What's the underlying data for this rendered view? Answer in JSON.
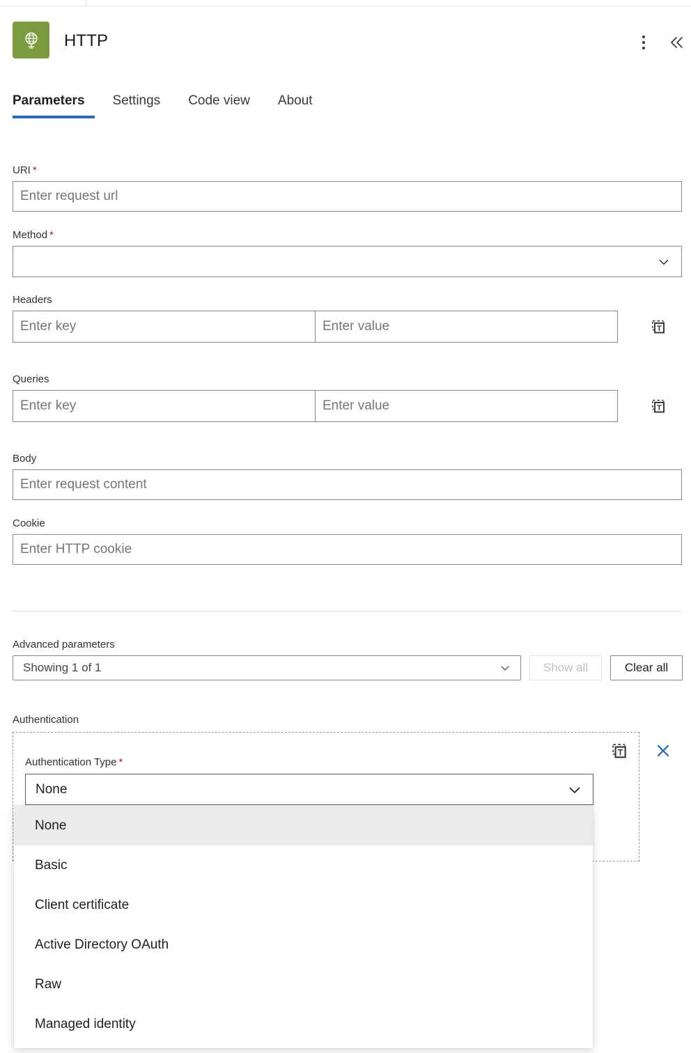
{
  "header": {
    "title": "HTTP",
    "icon": "globe-icon",
    "icon_color": "#7a9c3f",
    "more_menu": "more-vertical-icon",
    "collapse": "chevron-double-left-icon"
  },
  "tabs": [
    {
      "label": "Parameters",
      "active": true
    },
    {
      "label": "Settings",
      "active": false
    },
    {
      "label": "Code view",
      "active": false
    },
    {
      "label": "About",
      "active": false
    }
  ],
  "accent_color": "#2b6cb4",
  "required_star": "*",
  "fields": {
    "uri": {
      "label": "URI",
      "required": true,
      "placeholder": "Enter request url",
      "value": ""
    },
    "method": {
      "label": "Method",
      "required": true,
      "placeholder": "",
      "value": ""
    },
    "headers": {
      "label": "Headers",
      "key_placeholder": "Enter key",
      "value_placeholder": "Enter value",
      "key_value": "",
      "value_value": "",
      "icon": "text-mode-icon"
    },
    "queries": {
      "label": "Queries",
      "key_placeholder": "Enter key",
      "value_placeholder": "Enter value",
      "key_value": "",
      "value_value": "",
      "icon": "text-mode-icon"
    },
    "body": {
      "label": "Body",
      "placeholder": "Enter request content",
      "value": ""
    },
    "cookie": {
      "label": "Cookie",
      "placeholder": "Enter HTTP cookie",
      "value": ""
    }
  },
  "advanced": {
    "label": "Advanced parameters",
    "select_value": "Showing 1 of 1",
    "show_all_label": "Show all",
    "show_all_disabled": true,
    "clear_all_label": "Clear all",
    "clear_all_disabled": false
  },
  "authentication": {
    "label": "Authentication",
    "type_label": "Authentication Type",
    "type_required": true,
    "selected_value": "None",
    "text_mode_icon": "text-mode-icon",
    "close_icon": "close-icon",
    "close_icon_color": "#2b6cb4",
    "options": [
      {
        "label": "None",
        "selected": true
      },
      {
        "label": "Basic",
        "selected": false
      },
      {
        "label": "Client certificate",
        "selected": false
      },
      {
        "label": "Active Directory OAuth",
        "selected": false
      },
      {
        "label": "Raw",
        "selected": false
      },
      {
        "label": "Managed identity",
        "selected": false
      }
    ]
  }
}
